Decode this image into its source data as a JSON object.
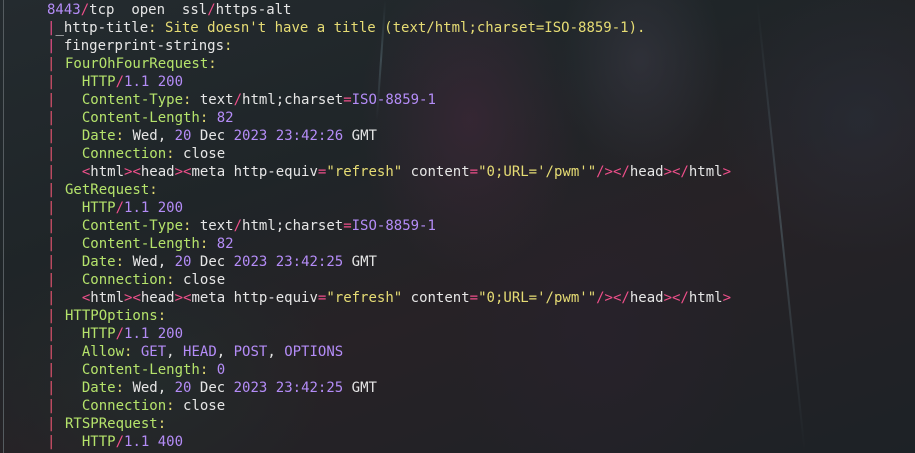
{
  "terminal": {
    "port_line": {
      "port": "8443",
      "slash": "/",
      "proto": "tcp",
      "state": "open",
      "svc1": "ssl",
      "svc2": "https-alt"
    },
    "http_title": {
      "key": "_http-title",
      "value": "Site doesn't have a title (text/html;charset=ISO-8859-1)."
    },
    "fingerprint": {
      "key": "fingerprint-strings"
    },
    "sections": {
      "fourohfour": {
        "name": "FourOhFourRequest",
        "status": {
          "proto": "HTTP",
          "ver": "1.1",
          "code": "200"
        },
        "content_type": {
          "key": "Content-Type",
          "type": "text",
          "sub": "html;charset",
          "val": "ISO-8859-1"
        },
        "content_length": {
          "key": "Content-Length",
          "val": "82"
        },
        "date": {
          "key": "Date",
          "day": "Wed",
          "d": "20",
          "mon": "Dec",
          "yr": "2023",
          "time": "23:42:26",
          "tz": "GMT"
        },
        "connection": {
          "key": "Connection",
          "val": "close"
        },
        "html": {
          "html": "html",
          "head": "head",
          "meta": "meta http-equiv",
          "eq1": "refresh",
          "content": " content",
          "eq2": "0;URL='/pwm'"
        }
      },
      "getrequest": {
        "name": "GetRequest",
        "status": {
          "proto": "HTTP",
          "ver": "1.1",
          "code": "200"
        },
        "content_type": {
          "key": "Content-Type",
          "type": "text",
          "sub": "html;charset",
          "val": "ISO-8859-1"
        },
        "content_length": {
          "key": "Content-Length",
          "val": "82"
        },
        "date": {
          "key": "Date",
          "day": "Wed",
          "d": "20",
          "mon": "Dec",
          "yr": "2023",
          "time": "23:42:25",
          "tz": "GMT"
        },
        "connection": {
          "key": "Connection",
          "val": "close"
        },
        "html": {
          "html": "html",
          "head": "head",
          "meta": "meta http-equiv",
          "eq1": "refresh",
          "content": " content",
          "eq2": "0;URL='/pwm'"
        }
      },
      "httpoptions": {
        "name": "HTTPOptions",
        "status": {
          "proto": "HTTP",
          "ver": "1.1",
          "code": "200"
        },
        "allow": {
          "key": "Allow",
          "v1": "GET",
          "v2": "HEAD",
          "v3": "POST",
          "v4": "OPTIONS"
        },
        "content_length": {
          "key": "Content-Length",
          "val": "0"
        },
        "date": {
          "key": "Date",
          "day": "Wed",
          "d": "20",
          "mon": "Dec",
          "yr": "2023",
          "time": "23:42:25",
          "tz": "GMT"
        },
        "connection": {
          "key": "Connection",
          "val": "close"
        }
      },
      "rtsp": {
        "name": "RTSPRequest",
        "status": {
          "proto": "HTTP",
          "ver": "1.1",
          "code": "400"
        }
      }
    },
    "colors": {
      "bar": "#e0536e",
      "key": "#b5e36b",
      "string": "#e6dc74",
      "number": "#b48cf7",
      "punct": "#ee4f8a",
      "text": "#e6e6e6"
    }
  }
}
